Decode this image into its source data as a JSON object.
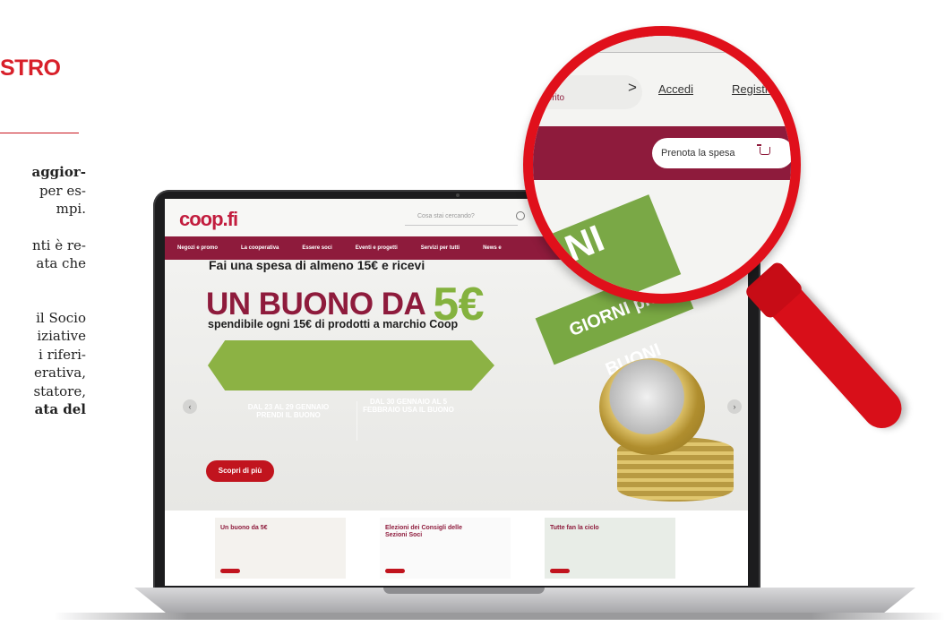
{
  "magazine": {
    "heading": "STRO",
    "lines": [
      {
        "text": "aggior-",
        "bold": true
      },
      {
        "text": "per es-",
        "bold": false
      },
      {
        "text": "mpi.",
        "bold": false
      },
      {
        "text": "",
        "gap": true
      },
      {
        "text": "nti è re-",
        "bold": false
      },
      {
        "text": "ata che",
        "bold": false
      },
      {
        "text": "",
        "gap": true
      },
      {
        "text": "",
        "gap": true
      },
      {
        "text": "il Socio",
        "bold": false
      },
      {
        "text": "iziative",
        "bold": false
      },
      {
        "text": "i riferi-",
        "bold": false
      },
      {
        "text": "erativa,",
        "bold": false
      },
      {
        "text": "statore,",
        "bold": false
      },
      {
        "text": "ata del",
        "bold": true
      }
    ]
  },
  "site": {
    "logo": "coop.fi",
    "search_placeholder": "Cosa stai cercando?",
    "nav": [
      "Negozi e promo",
      "La cooperativa",
      "Essere soci",
      "Eventi e progetti",
      "Servizi per tutti",
      "News e"
    ],
    "hero": {
      "line1": "Fai una spesa di almeno 15€ e ricevi",
      "big": "UN BUONO DA",
      "big_value": "5€",
      "line3": "spendibile ogni 15€ di prodotti a marchio Coop",
      "period1": "DAL 23 AL 29 GENNAIO PRENDI IL BUONO",
      "period2": "DAL 30 GENNAIO AL 5 FEBBRAIO USA IL BUONO",
      "cta": "Scopri di più",
      "ticket": "GIORNI più BUONI"
    },
    "cards": [
      {
        "title": "Un buono da 5€"
      },
      {
        "title": "Elezioni dei Consigli delle Sezioni Soci"
      },
      {
        "title": "Tutte fan la ciclo"
      }
    ]
  },
  "magnifier": {
    "preferito": "referito",
    "chevron": ">",
    "accedi": "Accedi",
    "registrati": "Registrat",
    "prenota": "Prenota la spesa",
    "ticket": "NI"
  },
  "colors": {
    "coop_bordeaux": "#8e1b3c",
    "magnifier_red": "#e0101b",
    "promo_green": "#84b23e",
    "heading_red": "#d8202a"
  }
}
